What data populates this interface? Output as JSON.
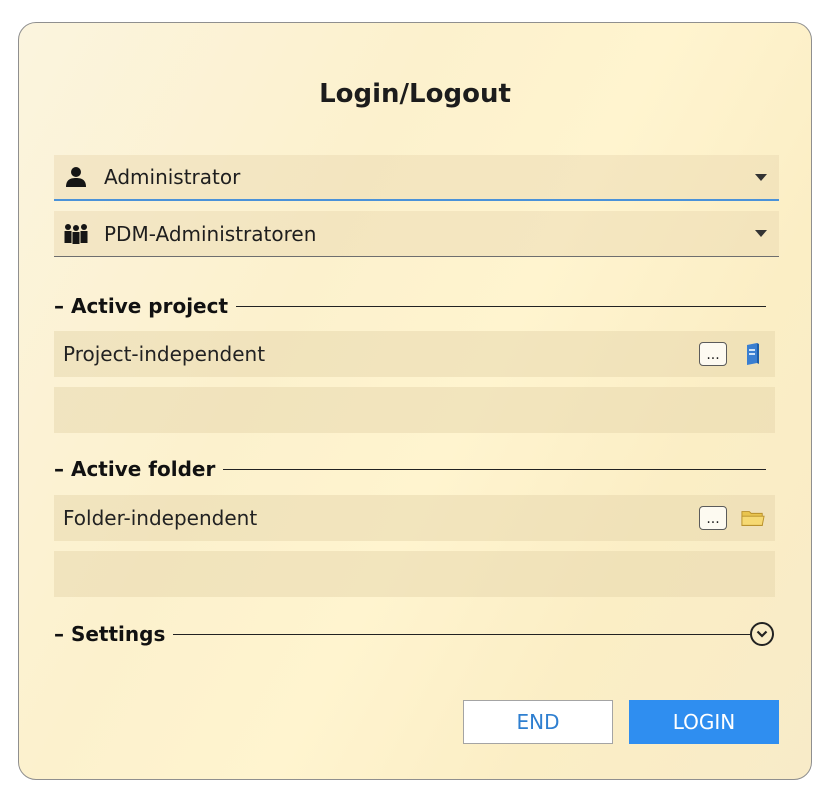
{
  "dialog": {
    "title": "Login/Logout"
  },
  "user_combo": {
    "value": "Administrator",
    "icon": "user-icon"
  },
  "group_combo": {
    "value": "PDM-Administratoren",
    "icon": "group-icon"
  },
  "sections": {
    "project": "– Active project",
    "folder": "– Active folder",
    "settings": "– Settings"
  },
  "project": {
    "value": "Project-independent",
    "browse_label": "...",
    "icon": "project-book-icon"
  },
  "folder": {
    "value": "Folder-independent",
    "browse_label": "...",
    "icon": "folder-icon"
  },
  "buttons": {
    "end": "END",
    "login": "LOGIN"
  },
  "colors": {
    "accent": "#2f8ef0",
    "background": "#fcf1cd"
  }
}
